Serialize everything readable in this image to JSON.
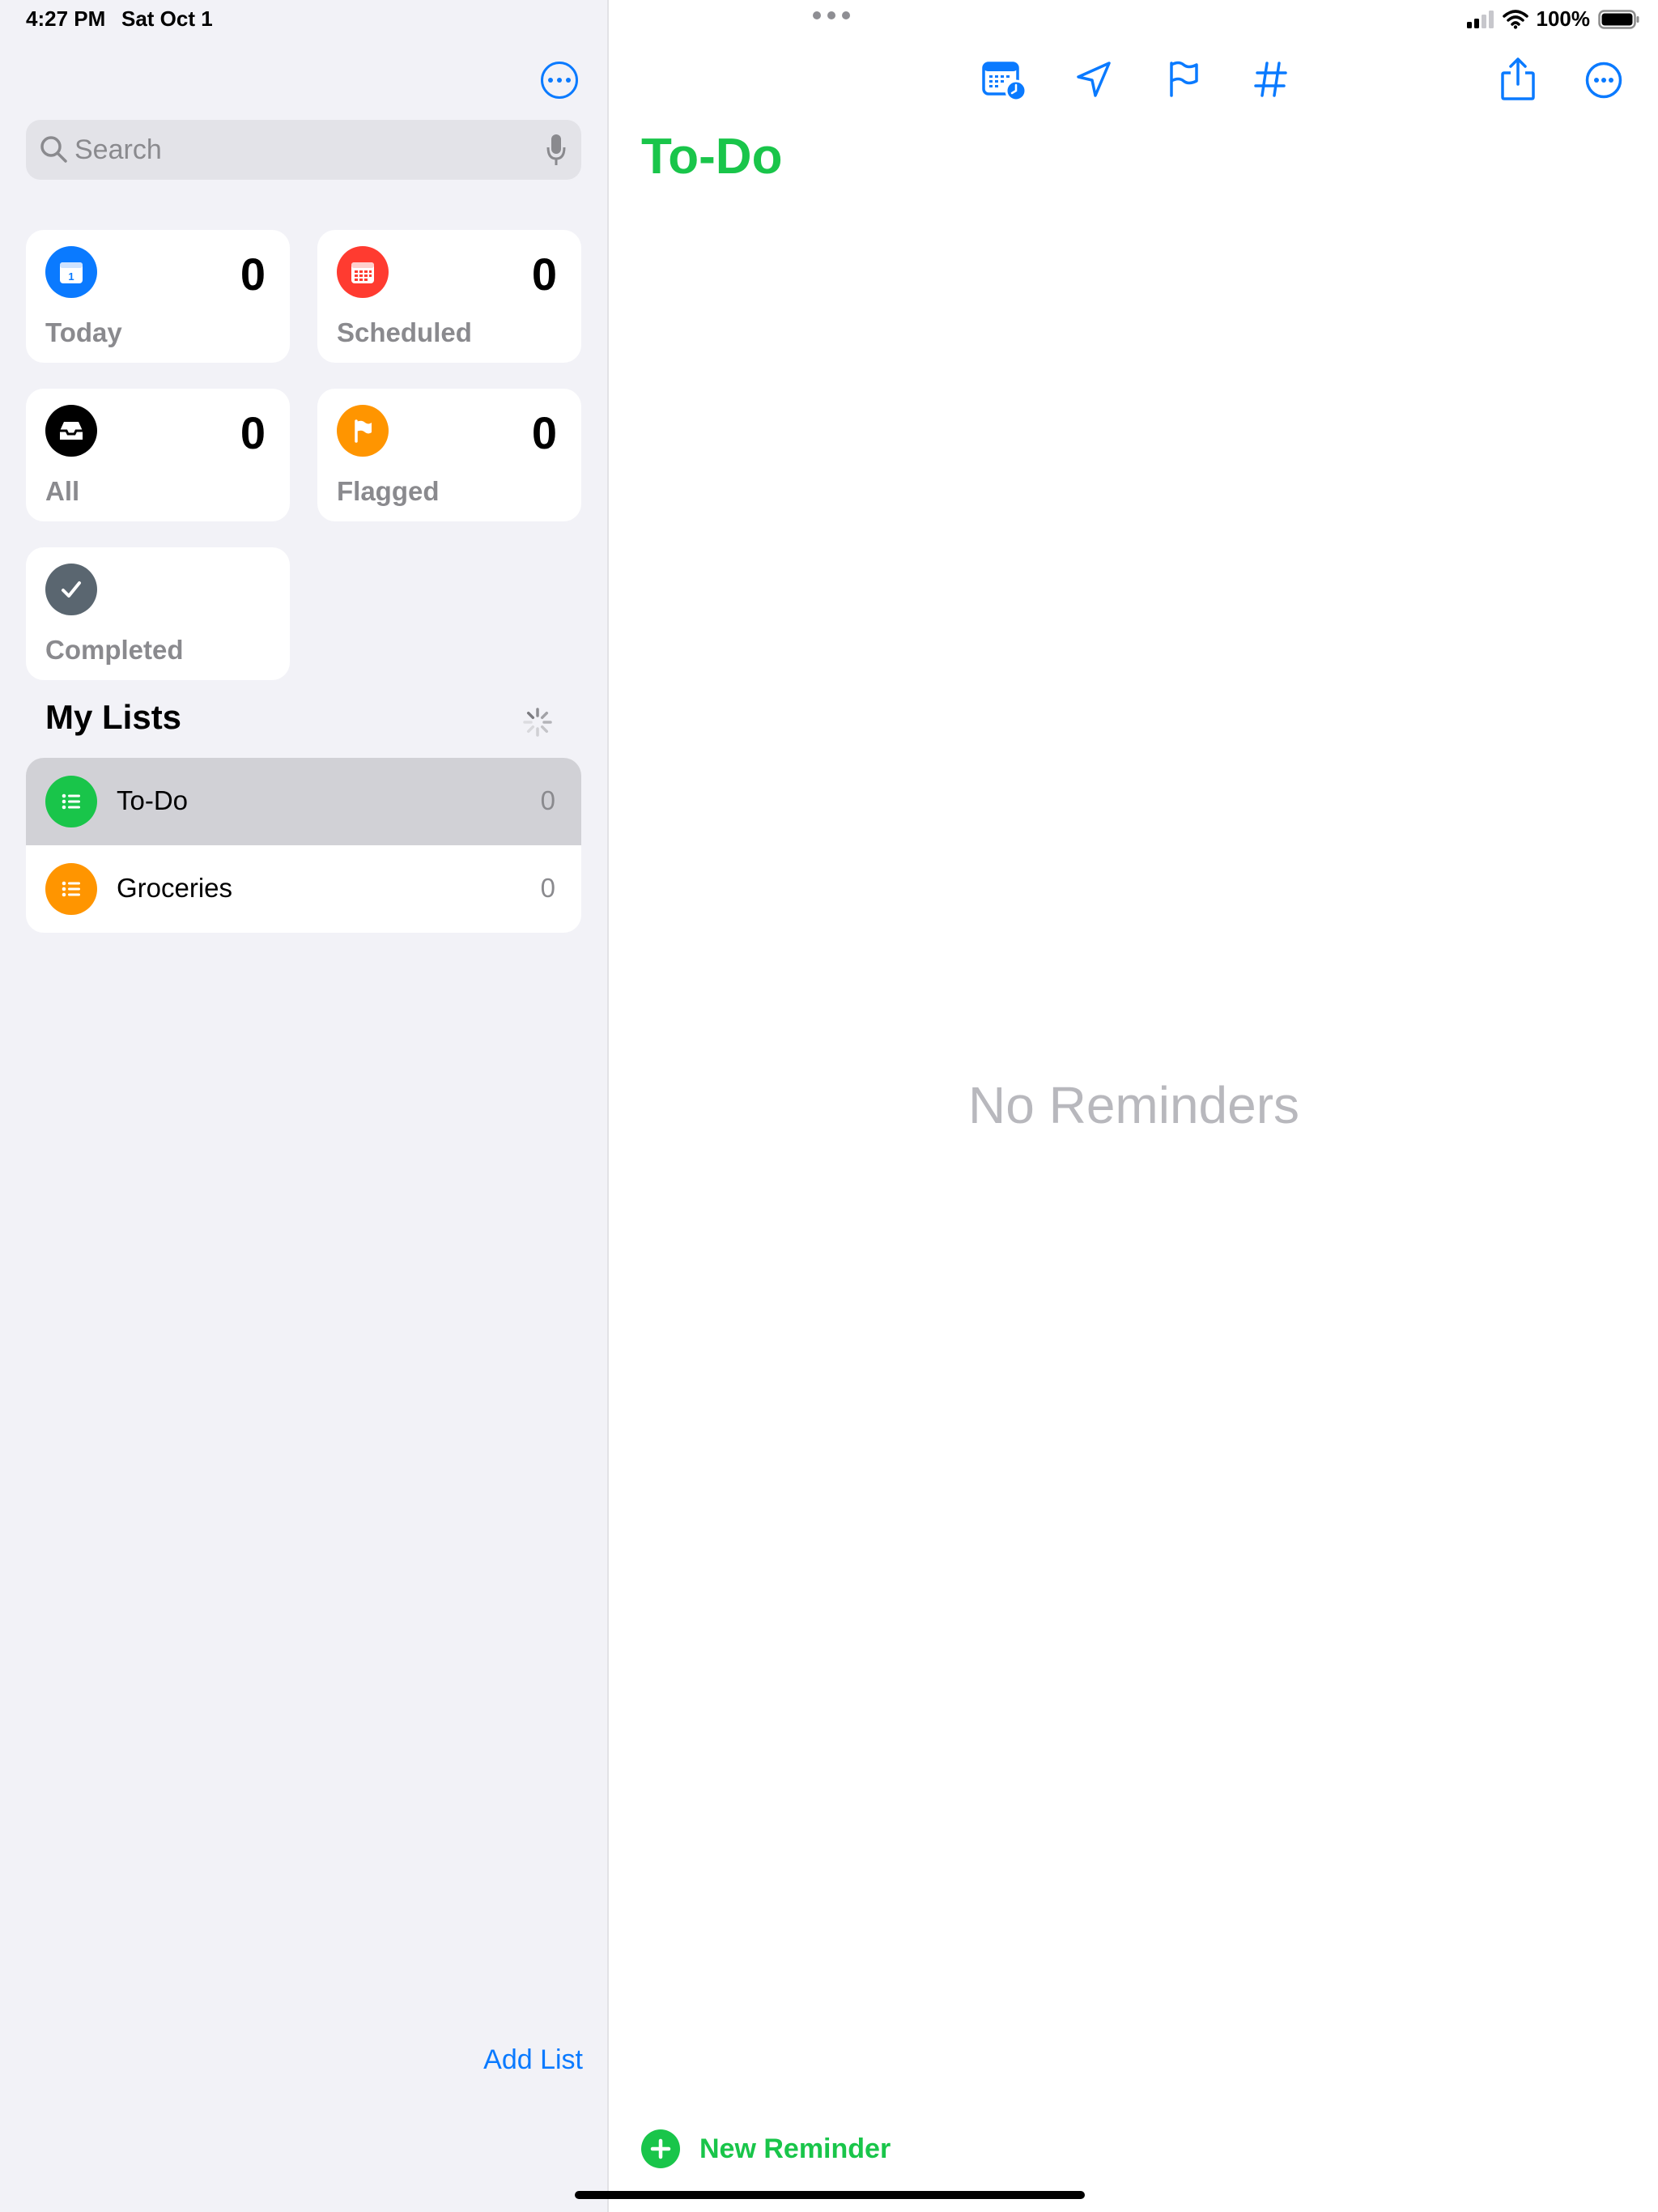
{
  "status_bar": {
    "time": "4:27 PM",
    "date": "Sat Oct 1",
    "battery": "100%"
  },
  "sidebar": {
    "more_icon": "ellipsis-circle-icon",
    "search": {
      "placeholder": "Search",
      "value": ""
    },
    "smart_lists": [
      {
        "label": "Today",
        "count": "0",
        "icon": "calendar-today-icon",
        "color": "#0a7aff"
      },
      {
        "label": "Scheduled",
        "count": "0",
        "icon": "calendar-grid-icon",
        "color": "#ff3b30"
      },
      {
        "label": "All",
        "count": "0",
        "icon": "tray-icon",
        "color": "#000000"
      },
      {
        "label": "Flagged",
        "count": "0",
        "icon": "flag-icon",
        "color": "#ff9500"
      },
      {
        "label": "Completed",
        "icon": "checkmark-icon",
        "color": "#5a6670"
      }
    ],
    "my_lists_title": "My Lists",
    "lists": [
      {
        "name": "To-Do",
        "count": "0",
        "color": "#19c54a",
        "selected": true
      },
      {
        "name": "Groceries",
        "count": "0",
        "color": "#ff9500",
        "selected": false
      }
    ],
    "add_list": "Add List"
  },
  "main": {
    "title": "To-Do",
    "title_color": "#19c54a",
    "empty_text": "No Reminders",
    "new_reminder": "New Reminder",
    "toolbar_icons": [
      "calendar-clock-icon",
      "location-icon",
      "flag-icon",
      "hashtag-icon",
      "share-icon",
      "ellipsis-circle-icon"
    ]
  },
  "colors": {
    "accent": "#0a7aff",
    "sidebar_bg": "#f2f2f7",
    "selected_row": "#d1d1d6"
  }
}
